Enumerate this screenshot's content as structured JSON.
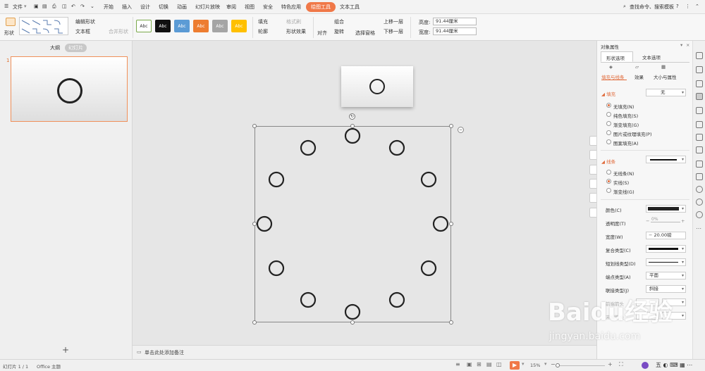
{
  "menu": {
    "file": "文件",
    "items": [
      "开始",
      "插入",
      "设计",
      "切换",
      "动画",
      "幻灯片放映",
      "审阅",
      "视图",
      "安全",
      "特色应用"
    ],
    "active_tab": "绘图工具",
    "text_tool": "文本工具",
    "search": "查找命令、搜索模板"
  },
  "ribbon": {
    "shape": "形状",
    "edit_shape": "编辑形状",
    "textbox": "文本框",
    "merge_shape": "合并形状",
    "styles": [
      {
        "label": "Abc",
        "bg": "#ffffff",
        "fg": "#333333",
        "border": "#7aa84a"
      },
      {
        "label": "Abc",
        "bg": "#111111",
        "fg": "#ffffff",
        "border": "#111111"
      },
      {
        "label": "Abc",
        "bg": "#5b9bd5",
        "fg": "#ffffff",
        "border": "#5b9bd5"
      },
      {
        "label": "Abc",
        "bg": "#ed7d31",
        "fg": "#ffffff",
        "border": "#ed7d31"
      },
      {
        "label": "Abc",
        "bg": "#a5a5a5",
        "fg": "#ffffff",
        "border": "#a5a5a5"
      },
      {
        "label": "Abc",
        "bg": "#ffc000",
        "fg": "#ffffff",
        "border": "#ffc000"
      }
    ],
    "fill": "填充",
    "format_painter": "格式刷",
    "outline": "轮廓",
    "shape_effect": "形状效果",
    "align": "对齐",
    "group": "组合",
    "rotate": "旋转",
    "select_pane": "选择窗格",
    "bring_forward": "上移一层",
    "send_backward": "下移一层",
    "height_label": "高度:",
    "height_value": "91.44厘米",
    "width_label": "宽度:",
    "width_value": "91.44厘米"
  },
  "left": {
    "tab_outline": "大纲",
    "tab_slides": "幻灯片",
    "slide_number": "1",
    "add": "+"
  },
  "notes": "单击此处添加备注",
  "panel": {
    "title": "对象属性",
    "tab_shape": "形状选项",
    "tab_text": "文本选项",
    "sub_fill_line": "填充与线条",
    "sub_effect": "效果",
    "sub_size": "大小与属性",
    "fill_section": "填充",
    "fill_value": "无",
    "fill_options": [
      "无填充(N)",
      "纯色填充(S)",
      "渐变填充(G)",
      "图片或纹理填充(P)",
      "图案填充(A)"
    ],
    "line_section": "线条",
    "line_options": [
      "无线条(N)",
      "实线(S)",
      "渐变线(G)"
    ],
    "color": "颜色(C)",
    "color_value": "#222222",
    "transparency": "透明度(T)",
    "transparency_value": "0%",
    "width": "宽度(W)",
    "width_value": "20.00磅",
    "compound": "复合类型(C)",
    "dash": "短划线类型(D)",
    "cap": "端点类型(A)",
    "cap_value": "平面",
    "join": "联接类型(J)",
    "join_value": "斜接",
    "arrow_start": "前端箭头",
    "arrow_end": "末端箭头"
  },
  "status": {
    "slide_count": "幻灯片 1 / 1",
    "theme": "Office 主题",
    "zoom": "15%"
  },
  "watermark": {
    "main": "Baidu经验",
    "sub": "jingyan.baidu.com"
  },
  "accent": "#f07848"
}
